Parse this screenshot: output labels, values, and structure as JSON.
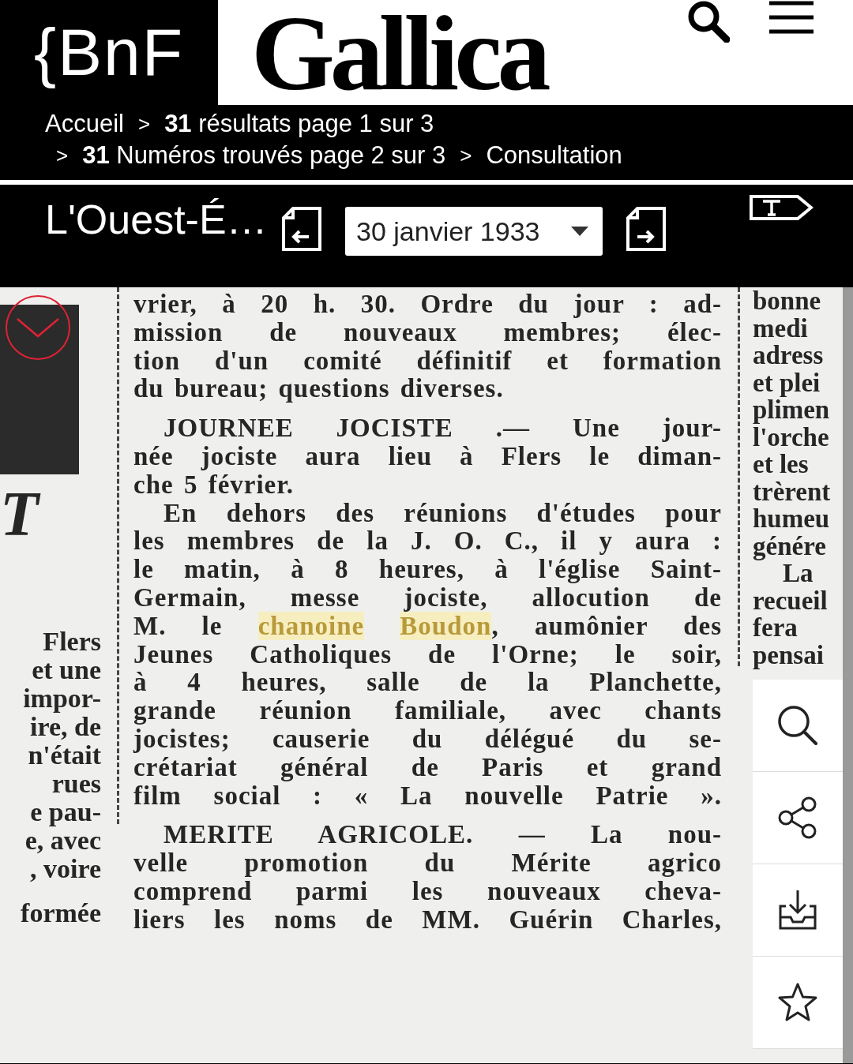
{
  "header": {
    "logo": "{BnF",
    "brand": "Gallica"
  },
  "breadcrumb": {
    "lines": [
      [
        {
          "kind": "link",
          "text": "Accueil"
        },
        {
          "kind": "sep",
          "text": ">"
        },
        {
          "kind": "link",
          "text": "**31** résultats page 1 sur 3"
        }
      ],
      [
        {
          "kind": "sep",
          "text": ">"
        },
        {
          "kind": "link",
          "text": "**31** Numéros trouvés page 2 sur 3"
        },
        {
          "kind": "sep",
          "text": ">"
        },
        {
          "kind": "current",
          "text": "Consultation"
        }
      ]
    ]
  },
  "toolbar": {
    "title": "L'Ouest-É…",
    "date": "30 janvier 1933"
  },
  "document": {
    "left_column": {
      "initial": "T",
      "lines": [
        "Flers",
        "et une",
        "impor-",
        "ire, de",
        "n'était",
        "rues",
        "e pau-",
        "e, avec",
        ", voire",
        "formée"
      ]
    },
    "center_column": [
      {
        "kind": "line",
        "text": "vrier, à 20 h. 30. Ordre du jour : ad-"
      },
      {
        "kind": "line",
        "text": "mission de nouveaux membres; élec-"
      },
      {
        "kind": "line",
        "text": "tion d'un comité définitif et formation"
      },
      {
        "kind": "last",
        "text": "du bureau; questions diverses."
      },
      {
        "kind": "start",
        "text": "JOURNEE JOCISTE .— Une jour-"
      },
      {
        "kind": "line",
        "text": "née jociste aura lieu à Flers le diman-"
      },
      {
        "kind": "last",
        "text": "che 5 février."
      },
      {
        "kind": "indent",
        "text": "En dehors des réunions d'études pour"
      },
      {
        "kind": "line",
        "text": "les membres de la J. O. C., il y aura :"
      },
      {
        "kind": "line",
        "text": "le matin, à 8 heures, à l'église Saint-"
      },
      {
        "kind": "line",
        "text": "Germain, messe jociste, allocution de"
      },
      {
        "kind": "line",
        "parts": [
          {
            "text": "M. le",
            "highlighted": false
          },
          {
            "text": "chanoine",
            "highlighted": true
          },
          {
            "text": "Boudon",
            "highlighted": true
          },
          {
            "text": ", aumônier des",
            "highlighted": false,
            "joined": true
          }
        ]
      },
      {
        "kind": "line",
        "text": "Jeunes Catholiques de l'Orne; le soir,"
      },
      {
        "kind": "line",
        "text": "à 4 heures, salle de la Planchette,"
      },
      {
        "kind": "line",
        "text": "grande réunion familiale, avec chants"
      },
      {
        "kind": "line",
        "text": "jocistes; causerie du délégué du se-"
      },
      {
        "kind": "line",
        "text": "crétariat général de Paris et grand"
      },
      {
        "kind": "line",
        "text": "film social : « La nouvelle Patrie »."
      },
      {
        "kind": "start",
        "text": "MERITE AGRICOLE. — La nou-"
      },
      {
        "kind": "line",
        "text": "velle promotion du Mérite agrico"
      },
      {
        "kind": "line",
        "text": "comprend parmi les nouveaux cheva-"
      },
      {
        "kind": "line",
        "text": "liers les noms de MM. Guérin Charles,"
      }
    ],
    "right_column": [
      "bonne",
      "medi",
      "adress",
      "et plei",
      "plimen",
      "l'orche",
      "et les",
      "trèrent",
      "humeu",
      "génére",
      "La",
      "recueil",
      "fera",
      "pensai"
    ]
  }
}
